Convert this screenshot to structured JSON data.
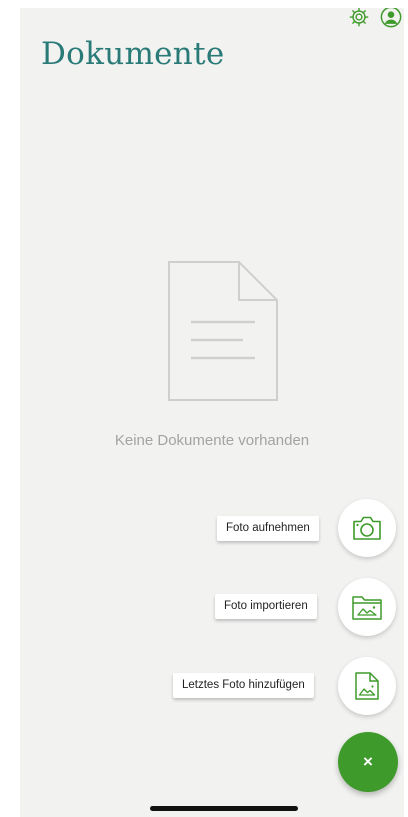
{
  "header": {
    "title": "Dokumente",
    "icons": [
      "gear-icon",
      "profile-icon"
    ]
  },
  "empty_state": {
    "icon": "document-icon",
    "message": "Keine Dokumente vorhanden"
  },
  "actions": [
    {
      "label": "Foto aufnehmen",
      "icon": "camera-icon"
    },
    {
      "label": "Foto importieren",
      "icon": "folder-image-icon"
    },
    {
      "label": "Letztes Foto hinzufügen",
      "icon": "document-image-icon"
    }
  ],
  "fab": {
    "label": "×",
    "icon": "close-icon"
  },
  "colors": {
    "accent": "#2a7a78",
    "fab_green": "#3e9a2a",
    "background": "#f2f2f1",
    "muted_text": "#a3a3a3"
  }
}
